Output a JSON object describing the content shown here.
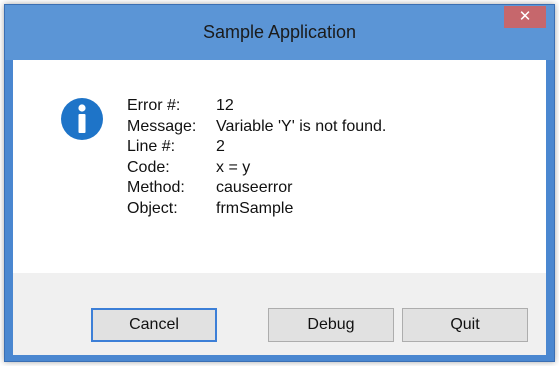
{
  "window": {
    "title": "Sample Application",
    "close_glyph": "✕"
  },
  "icon": "info-icon",
  "details": [
    {
      "label": "Error #:",
      "value": "12"
    },
    {
      "label": "Message:",
      "value": "Variable 'Y' is not found."
    },
    {
      "label": "Line #:",
      "value": "2"
    },
    {
      "label": "Code:",
      "value": "x = y"
    },
    {
      "label": "Method:",
      "value": "causeerror"
    },
    {
      "label": "Object:",
      "value": "frmSample"
    }
  ],
  "buttons": {
    "cancel_label": "Cancel",
    "debug_label": "Debug",
    "quit_label": "Quit"
  },
  "colors": {
    "frame": "#5b95d6",
    "close": "#c6676c",
    "info_icon": "#1e74c8",
    "default_button_border": "#3c7fd7"
  }
}
